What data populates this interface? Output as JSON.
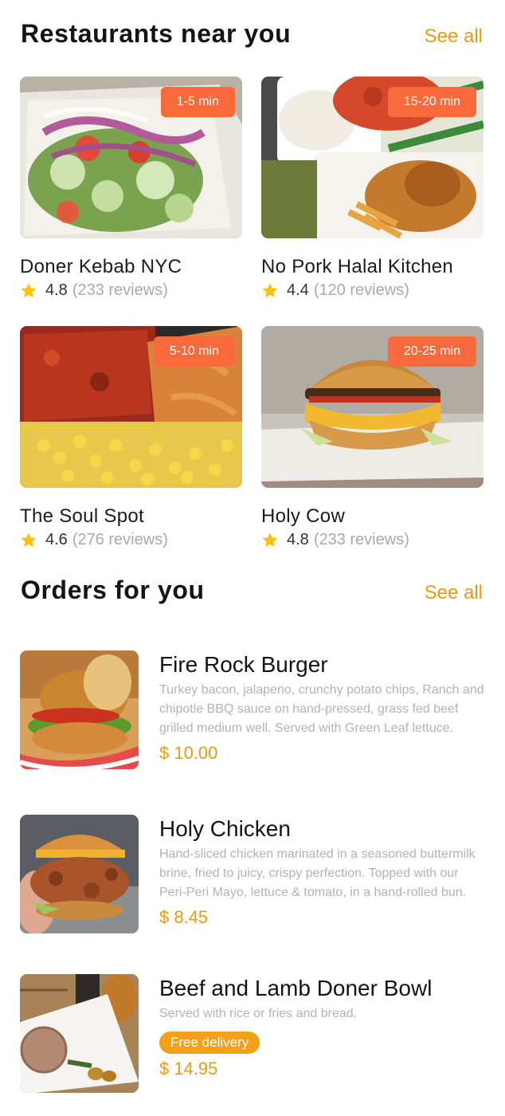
{
  "restaurants_section": {
    "title": "Restaurants near you",
    "see_all": "See all"
  },
  "restaurants": [
    {
      "name": "Doner Kebab NYC",
      "time": "1-5 min",
      "rating": "4.8",
      "reviews": "(233 reviews)"
    },
    {
      "name": "No Pork Halal Kitchen",
      "time": "15-20 min",
      "rating": "4.4",
      "reviews": "(120 reviews)"
    },
    {
      "name": "The Soul Spot",
      "time": "5-10 min",
      "rating": "4.6",
      "reviews": "(276 reviews)"
    },
    {
      "name": "Holy Cow",
      "time": "20-25 min",
      "rating": "4.8",
      "reviews": "(233 reviews)"
    }
  ],
  "orders_section": {
    "title": "Orders for you",
    "see_all": "See all"
  },
  "orders": [
    {
      "name": "Fire Rock Burger",
      "description": "Turkey bacon, jalapeno, crunchy potato chips, Ranch and chipotle BBQ sauce on hand-pressed, grass fed beef grilled medium well. Served with Green Leaf lettuce.",
      "price": "$ 10.00"
    },
    {
      "name": "Holy Chicken",
      "description": "Hand-sliced chicken marinated in a seasoned buttermilk brine, fried to juicy, crispy perfection. Topped with our Peri-Peri Mayo, lettuce & tomato, in a hand-rolled bun.",
      "price": "$ 8.45"
    },
    {
      "name": "Beef and Lamb Doner Bowl",
      "description": "Served with rice or fries and bread.",
      "badge": "Free delivery",
      "price": "$ 14.95"
    }
  ],
  "colors": {
    "accent": "#e89a10",
    "badge": "#f86a3c",
    "free_badge": "#f5a01a",
    "star": "#ffc107"
  }
}
